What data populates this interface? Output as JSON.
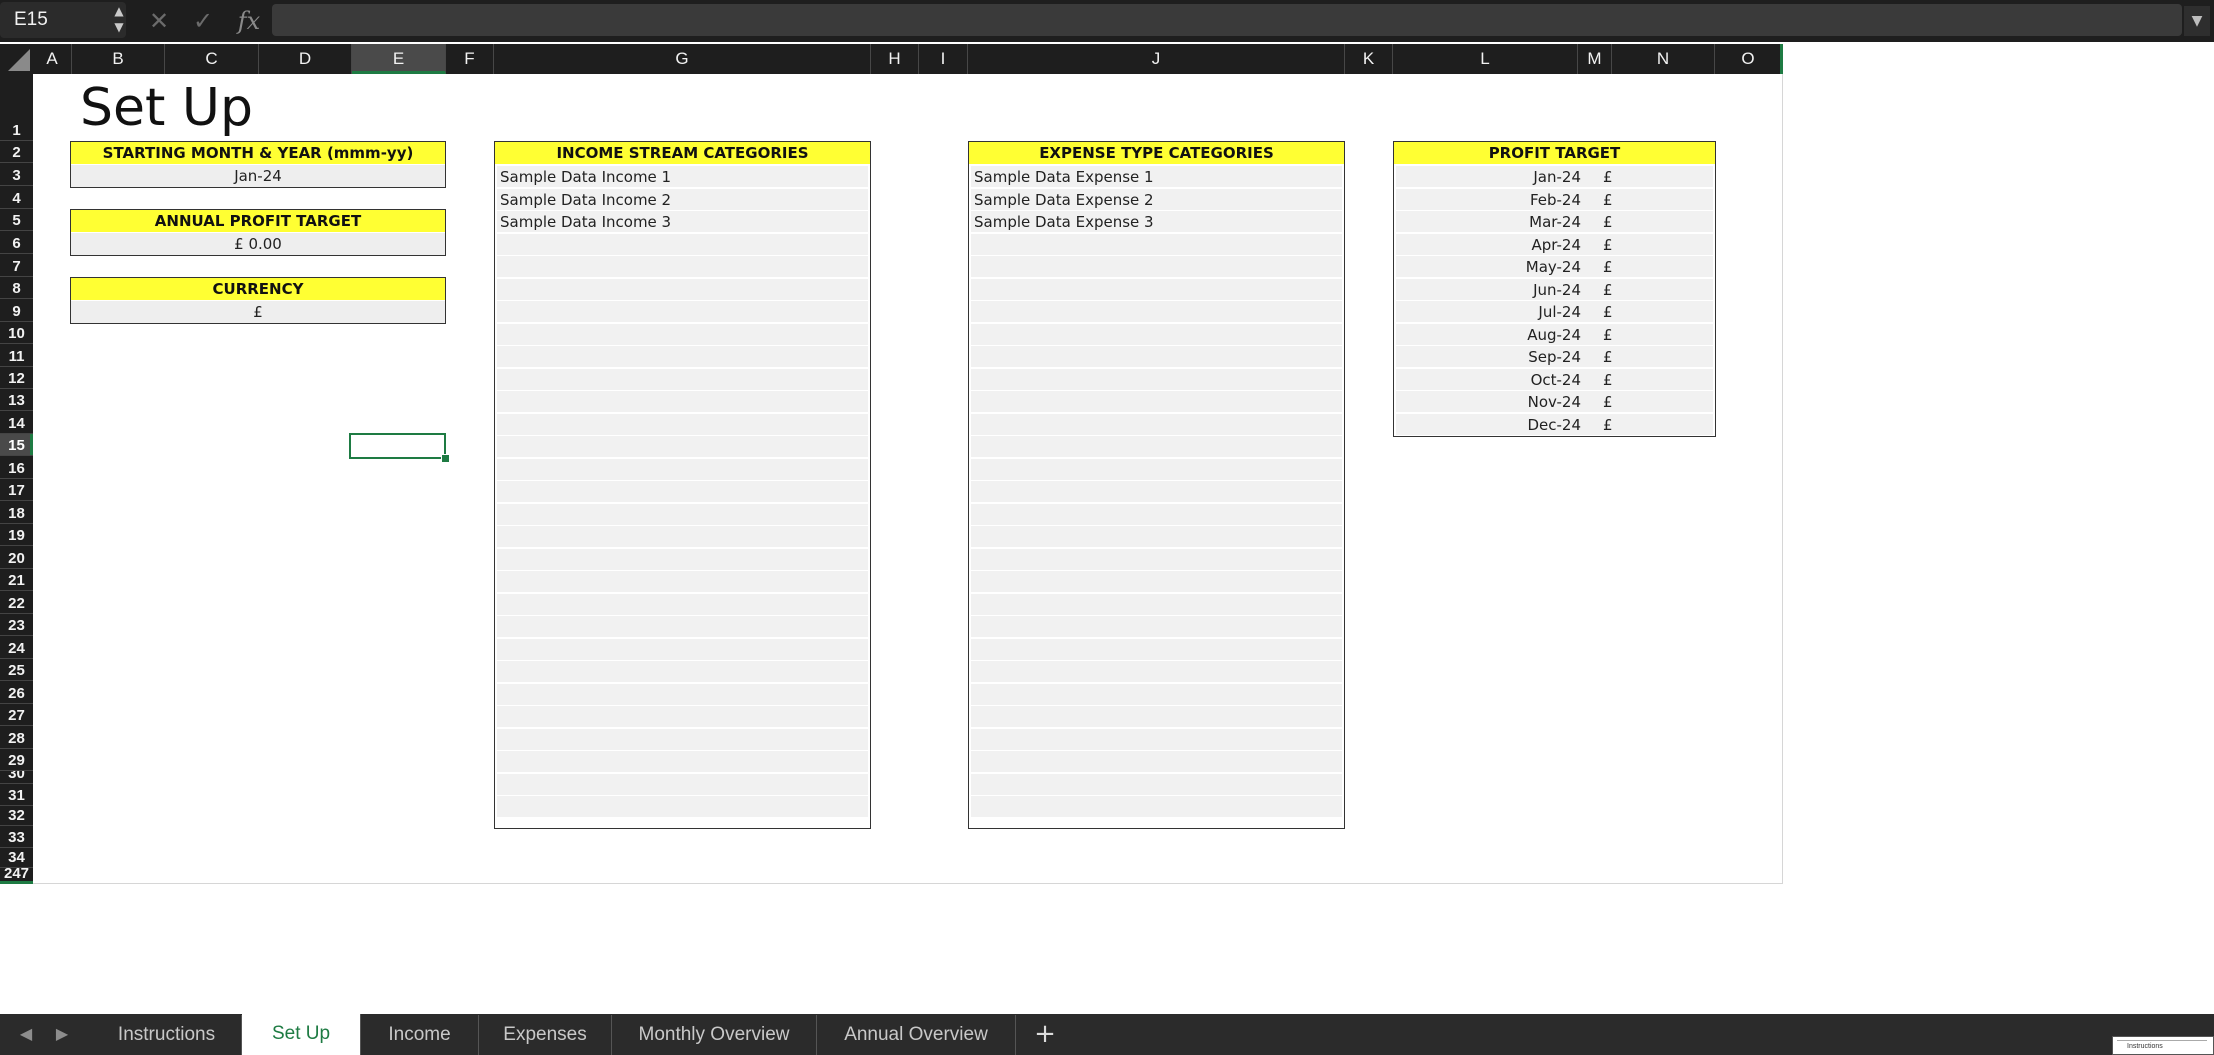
{
  "formula_bar": {
    "name_box": "E15",
    "cancel_icon": "close-icon",
    "confirm_icon": "check-icon",
    "fx_label": "fx",
    "formula_value": ""
  },
  "columns": [
    "A",
    "B",
    "C",
    "D",
    "E",
    "F",
    "G",
    "H",
    "I",
    "J",
    "K",
    "L",
    "M",
    "N",
    "O"
  ],
  "selected_column": "E",
  "rows": [
    "1",
    "2",
    "3",
    "4",
    "5",
    "6",
    "7",
    "8",
    "9",
    "10",
    "11",
    "12",
    "13",
    "14",
    "15",
    "16",
    "17",
    "18",
    "19",
    "20",
    "21",
    "22",
    "23",
    "24",
    "25",
    "26",
    "27",
    "28",
    "29",
    "30",
    "31",
    "32",
    "33",
    "34",
    "247"
  ],
  "selected_row": "15",
  "sheet": {
    "title": "Set Up",
    "starting_month": {
      "header": "STARTING MONTH & YEAR (mmm-yy)",
      "value": "Jan-24"
    },
    "annual_profit": {
      "header": "ANNUAL PROFIT TARGET",
      "value": "£  0.00"
    },
    "currency": {
      "header": "CURRENCY",
      "value": "£"
    },
    "income": {
      "header": "INCOME STREAM CATEGORIES",
      "items": [
        "Sample Data Income 1",
        "Sample Data Income 2",
        "Sample Data Income 3"
      ]
    },
    "expense": {
      "header": "EXPENSE TYPE CATEGORIES",
      "items": [
        "Sample Data Expense 1",
        "Sample Data Expense 2",
        "Sample Data Expense 3"
      ]
    },
    "profit_target": {
      "header": "PROFIT TARGET",
      "currency_symbol": "£",
      "months": [
        "Jan-24",
        "Feb-24",
        "Mar-24",
        "Apr-24",
        "May-24",
        "Jun-24",
        "Jul-24",
        "Aug-24",
        "Sep-24",
        "Oct-24",
        "Nov-24",
        "Dec-24"
      ]
    }
  },
  "tabs": [
    "Instructions",
    "Set Up",
    "Income",
    "Expenses",
    "Monthly Overview",
    "Annual Overview"
  ],
  "active_tab": "Set Up",
  "mini_preview_text": "Instructions",
  "colors": {
    "accent_green": "#1e7b43",
    "header_yellow": "#ffff33"
  }
}
